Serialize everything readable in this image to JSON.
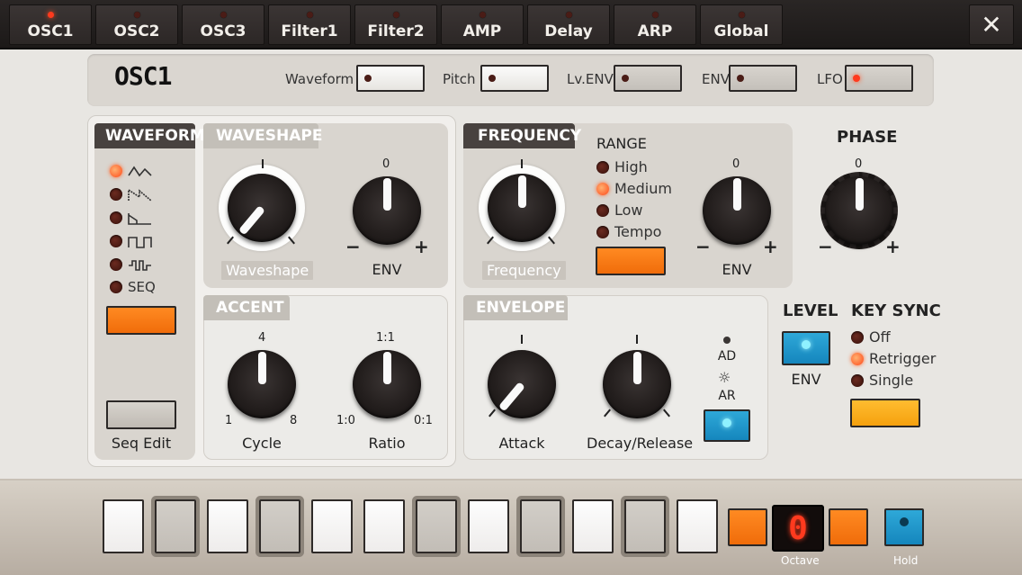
{
  "tabs": [
    {
      "label": "OSC1",
      "active": true
    },
    {
      "label": "OSC2",
      "active": false
    },
    {
      "label": "OSC3",
      "active": false
    },
    {
      "label": "Filter1",
      "active": false
    },
    {
      "label": "Filter2",
      "active": false
    },
    {
      "label": "AMP",
      "active": false
    },
    {
      "label": "Delay",
      "active": false
    },
    {
      "label": "ARP",
      "active": false
    },
    {
      "label": "Global",
      "active": false
    }
  ],
  "close_glyph": "✕",
  "header": {
    "title": "OSC1",
    "modulation": {
      "waveform": "Waveform",
      "pitch": "Pitch",
      "lv_env": "Lv.ENV",
      "env": "ENV",
      "lfo": "LFO"
    }
  },
  "waveform": {
    "title": "WAVEFORM",
    "options": [
      {
        "icon": "triangle-wave-icon",
        "on": true
      },
      {
        "icon": "saw-wave-icon",
        "on": false
      },
      {
        "icon": "ramp-wave-icon",
        "on": false
      },
      {
        "icon": "square-wave-icon",
        "on": false
      },
      {
        "icon": "pulse-wave-icon",
        "on": false
      },
      {
        "label": "SEQ",
        "on": false
      }
    ],
    "seq_edit": "Seq Edit"
  },
  "waveshape": {
    "title": "WAVESHAPE",
    "knob_label": "Waveshape",
    "env_label": "ENV",
    "env_zero": "0",
    "minus": "−",
    "plus": "+"
  },
  "accent": {
    "title": "ACCENT",
    "cycle": {
      "label": "Cycle",
      "top": "4",
      "min": "1",
      "max": "8"
    },
    "ratio": {
      "label": "Ratio",
      "top": "1:1",
      "min": "1:0",
      "max": "0:1"
    }
  },
  "frequency": {
    "title": "FREQUENCY",
    "knob_label": "Frequency",
    "range_title": "RANGE",
    "ranges": [
      {
        "label": "High",
        "on": false
      },
      {
        "label": "Medium",
        "on": true
      },
      {
        "label": "Low",
        "on": false
      },
      {
        "label": "Tempo",
        "on": false
      }
    ],
    "env_label": "ENV",
    "env_zero": "0"
  },
  "phase": {
    "title": "PHASE",
    "zero": "0"
  },
  "envelope": {
    "title": "ENVELOPE",
    "attack": "Attack",
    "decay": "Decay/Release",
    "ad": "AD",
    "ar": "AR"
  },
  "level": {
    "title": "LEVEL",
    "env": "ENV"
  },
  "key_sync": {
    "title": "KEY SYNC",
    "options": [
      {
        "label": "Off",
        "on": false
      },
      {
        "label": "Retrigger",
        "on": true
      },
      {
        "label": "Single",
        "on": false
      }
    ]
  },
  "keyboard": {
    "octave_value": "0",
    "octave_label": "Octave",
    "hold_label": "Hold"
  },
  "colors": {
    "accent_orange": "#f27a12",
    "amber": "#f7aa16",
    "blue": "#1e95c9",
    "led_red": "#ff3a1e"
  }
}
